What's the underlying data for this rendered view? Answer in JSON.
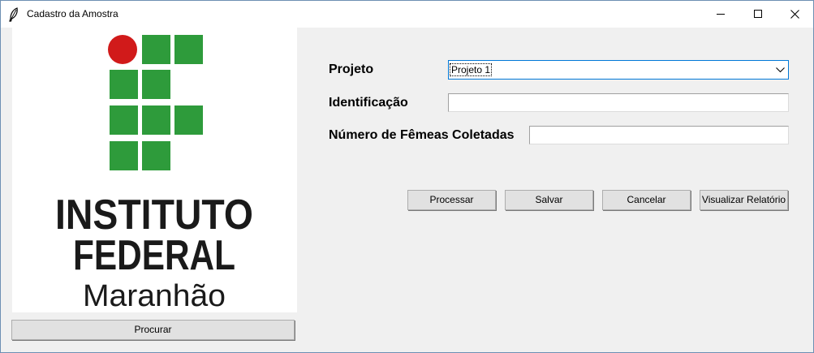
{
  "window": {
    "title": "Cadastro da Amostra",
    "icon": "feather-icon",
    "controls": [
      "minimize-icon",
      "maximize-icon",
      "close-icon"
    ]
  },
  "logo": {
    "line1": "INSTITUTO",
    "line2": "FEDERAL",
    "line3": "Maranhão",
    "colors": {
      "red": "#d11a1a",
      "green": "#2e9b3b",
      "text": "#1a1a1a"
    }
  },
  "form": {
    "projeto_label": "Projeto",
    "projeto_value": "Projeto 1",
    "identificacao_label": "Identificação",
    "identificacao_value": "",
    "femeas_label": "Número de Fêmeas Coletadas",
    "femeas_value": ""
  },
  "buttons": {
    "procurar": "Procurar",
    "processar": "Processar",
    "salvar": "Salvar",
    "cancelar": "Cancelar",
    "visualizar_relatorio": "Visualizar Relatório"
  },
  "colors": {
    "focus_border": "#0078d7",
    "window_bg": "#f0f0f0",
    "button_bg": "#e1e1e1"
  }
}
